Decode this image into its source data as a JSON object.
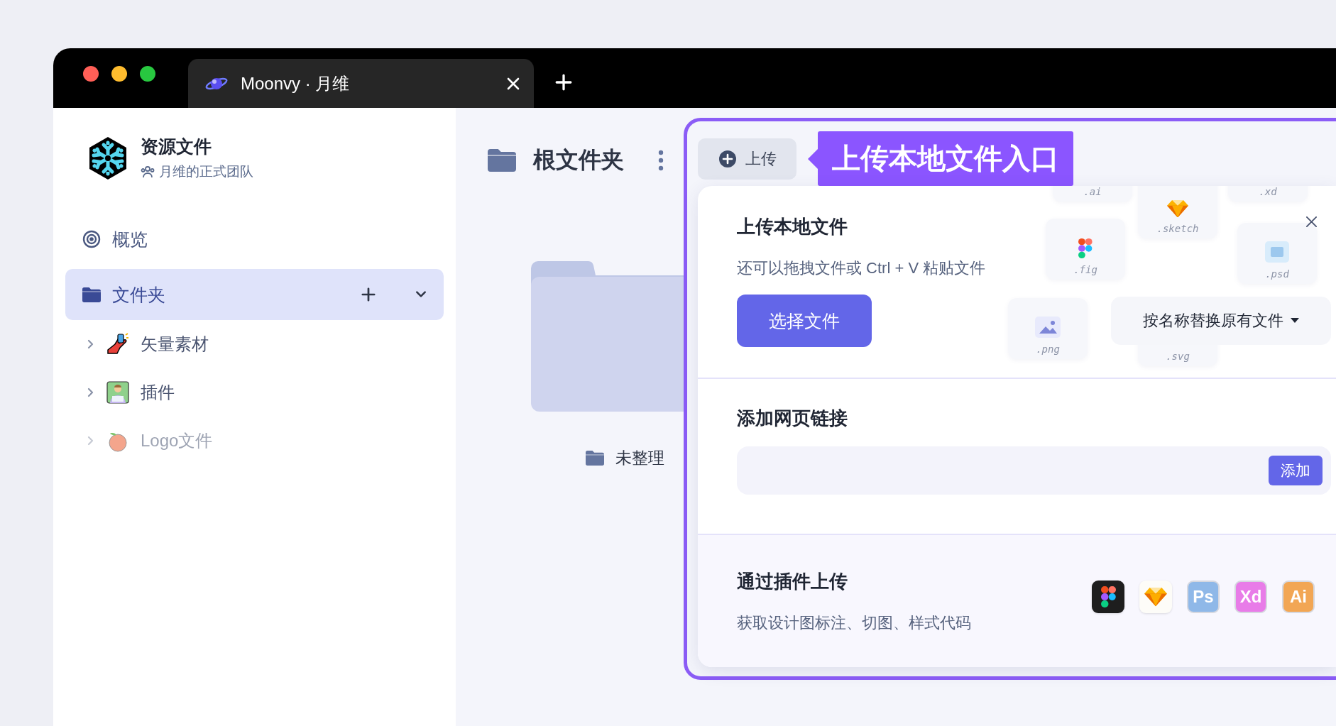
{
  "browser": {
    "tab_title": "Moonvy · 月维"
  },
  "sidebar": {
    "title": "资源文件",
    "team": "月维的正式团队",
    "nav": [
      {
        "label": "概览",
        "kind": "overview",
        "selected": false
      },
      {
        "label": "文件夹",
        "kind": "folders",
        "selected": true,
        "expanded": true,
        "children": [
          {
            "label": "矢量素材",
            "kind": "hand",
            "expanded": false,
            "disabled": false
          },
          {
            "label": "插件",
            "kind": "person",
            "expanded": false,
            "disabled": false
          },
          {
            "label": "Logo文件",
            "kind": "peach",
            "expanded": false,
            "disabled": true
          }
        ]
      }
    ]
  },
  "main": {
    "title": "根文件夹",
    "folders": [
      {
        "label": "未整理"
      }
    ]
  },
  "upload": {
    "button": "上传",
    "callout": "上传本地文件入口",
    "local": {
      "title": "上传本地文件",
      "hint": "还可以拖拽文件或 Ctrl + V 粘贴文件",
      "choose_button": "选择文件",
      "mode": "按名称替换原有文件",
      "file_types": [
        {
          "label": ".ai",
          "kind": "blank"
        },
        {
          "label": ".xd",
          "kind": "blank"
        },
        {
          "label": ".sketch",
          "kind": "sketch"
        },
        {
          "label": ".fig",
          "kind": "figma"
        },
        {
          "label": ".psd",
          "kind": "photoshop"
        },
        {
          "label": ".png",
          "kind": "image"
        },
        {
          "label": ".svg",
          "kind": "blank"
        }
      ]
    },
    "link": {
      "title": "添加网页链接",
      "button": "添加"
    },
    "plugins": {
      "title": "通过插件上传",
      "description": "获取设计图标注、切图、样式代码",
      "apps": [
        {
          "kind": "figma",
          "disabled": false
        },
        {
          "kind": "sketch",
          "disabled": false
        },
        {
          "kind": "letters",
          "label": "Ps",
          "color": "#8fb8e8",
          "disabled": true
        },
        {
          "kind": "letters",
          "label": "Xd",
          "color": "#e87ce8",
          "disabled": true
        },
        {
          "kind": "letters",
          "label": "Ai",
          "color": "#f2a654",
          "disabled": true
        }
      ]
    }
  }
}
